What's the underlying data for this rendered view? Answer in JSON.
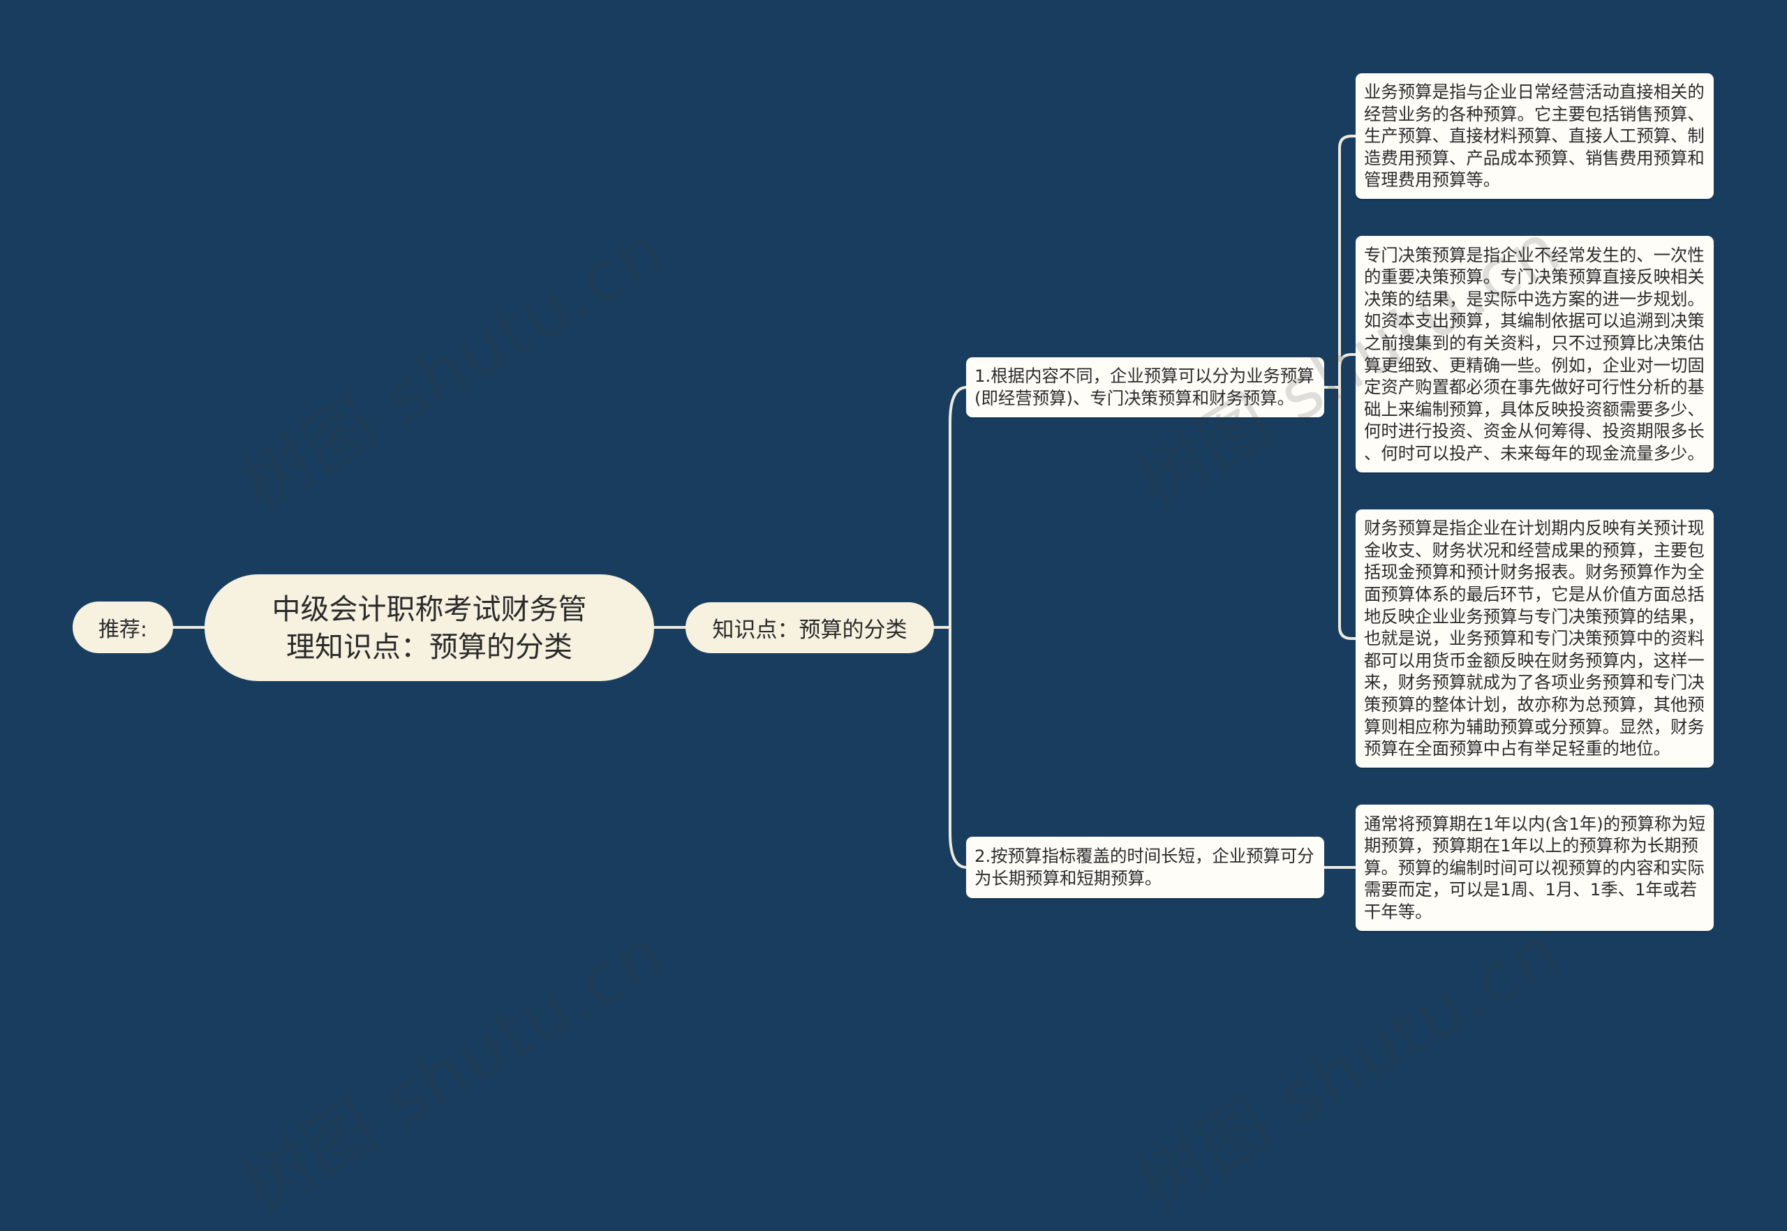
{
  "theme": {
    "background": "#183d5e",
    "node_fill": "#f7f2e0",
    "box_fill": "#fefdf8",
    "line": "#eeeade",
    "text": "#2b2b2b"
  },
  "watermark": "树图 shutu.cn",
  "recommend": {
    "label": "推荐:"
  },
  "root": {
    "title": "中级会计职称考试财务管理知识点：预算的分类"
  },
  "topic": {
    "label": "知识点：预算的分类"
  },
  "branches": [
    {
      "label": "1.根据内容不同，企业预算可以分为业务预算(即经营预算)、专门决策预算和财务预算。",
      "children": [
        {
          "text": "业务预算是指与企业日常经营活动直接相关的经营业务的各种预算。它主要包括销售预算、生产预算、直接材料预算、直接人工预算、制造费用预算、产品成本预算、销售费用预算和管理费用预算等。"
        },
        {
          "text": "专门决策预算是指企业不经常发生的、一次性的重要决策预算。专门决策预算直接反映相关决策的结果，是实际中选方案的进一步规划。如资本支出预算，其编制依据可以追溯到决策之前搜集到的有关资料，只不过预算比决策估算更细致、更精确一些。例如，企业对一切固定资产购置都必须在事先做好可行性分析的基础上来编制预算，具体反映投资额需要多少、何时进行投资、资金从何筹得、投资期限多长、何时可以投产、未来每年的现金流量多少。"
        },
        {
          "text": "财务预算是指企业在计划期内反映有关预计现金收支、财务状况和经营成果的预算，主要包括现金预算和预计财务报表。财务预算作为全面预算体系的最后环节，它是从价值方面总括地反映企业业务预算与专门决策预算的结果，也就是说，业务预算和专门决策预算中的资料都可以用货币金额反映在财务预算内，这样一来，财务预算就成为了各项业务预算和专门决策预算的整体计划，故亦称为总预算，其他预算则相应称为辅助预算或分预算。显然，财务预算在全面预算中占有举足轻重的地位。"
        }
      ]
    },
    {
      "label": "2.按预算指标覆盖的时间长短，企业预算可分为长期预算和短期预算。",
      "children": [
        {
          "text": "通常将预算期在1年以内(含1年)的预算称为短期预算，预算期在1年以上的预算称为长期预算。预算的编制时间可以视预算的内容和实际需要而定，可以是1周、1月、1季、1年或若干年等。"
        }
      ]
    }
  ]
}
